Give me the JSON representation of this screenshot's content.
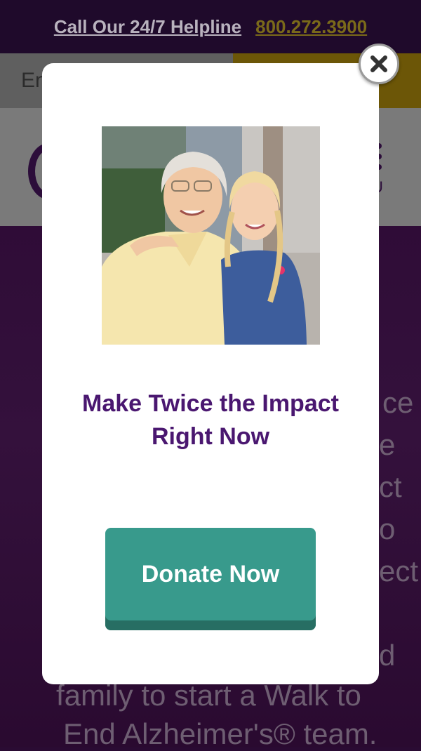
{
  "topbar": {
    "helpline_label": "Call Our 24/7 Helpline",
    "phone": "800.272.3900"
  },
  "header": {
    "language_label": "En",
    "menu_label": "U"
  },
  "hero": {
    "lines": [
      "ce",
      "e",
      "ct",
      "o",
      "ect",
      "d",
      "family to start a Walk to",
      "End Alzheimer's® team."
    ]
  },
  "modal": {
    "title": "Make Twice the Impact Right Now",
    "donate_label": "Donate Now",
    "photo_icon": "grandmother-and-granddaughter-photo",
    "close_icon": "close-icon"
  },
  "colors": {
    "title_purple": "#4a1770",
    "donate_teal": "#389a8c",
    "phone_gold": "#f5c400"
  }
}
